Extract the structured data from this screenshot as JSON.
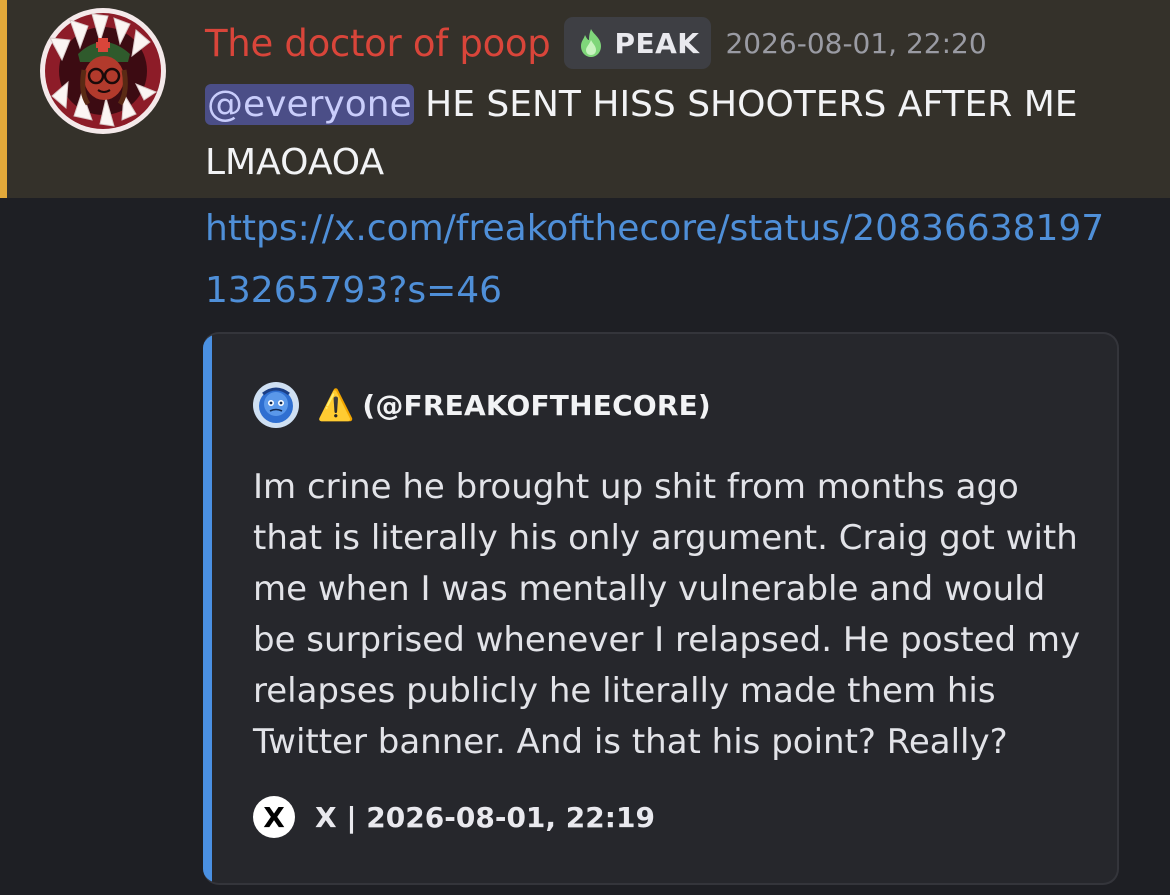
{
  "message": {
    "author": {
      "name": "The doctor of poop",
      "name_color": "#d9453a",
      "avatar_icon": "avatar-doctor-in-monster-mouth"
    },
    "tag": {
      "icon": "green-flame-icon",
      "label": "PEAK"
    },
    "timestamp": "2026-08-01, 22:20",
    "mention": "@everyone",
    "text": " HE SENT HISS SHOOTERS AFTER ME LMAOAOA",
    "link": "https://x.com/freakofthecore/status/2083663819713265793?s=46",
    "highlight_color": "#e3a93a"
  },
  "embed": {
    "accent_color": "#4a90e2",
    "author": {
      "avatar_icon": "blue-character-avatar",
      "warning_icon": "⚠️",
      "name": "(@FREAKOFTHECORE)"
    },
    "description": "Im crine he brought up shit from months ago that is literally his only argument. Craig got with me when I was mentally vulnerable and would be surprised whenever I relapsed. He posted my relapses publicly he literally made them his Twitter banner. And is that his point? Really?",
    "footer": {
      "icon": "x-logo-icon",
      "icon_glyph": "X",
      "text": "X | 2026-08-01, 22:19"
    }
  }
}
